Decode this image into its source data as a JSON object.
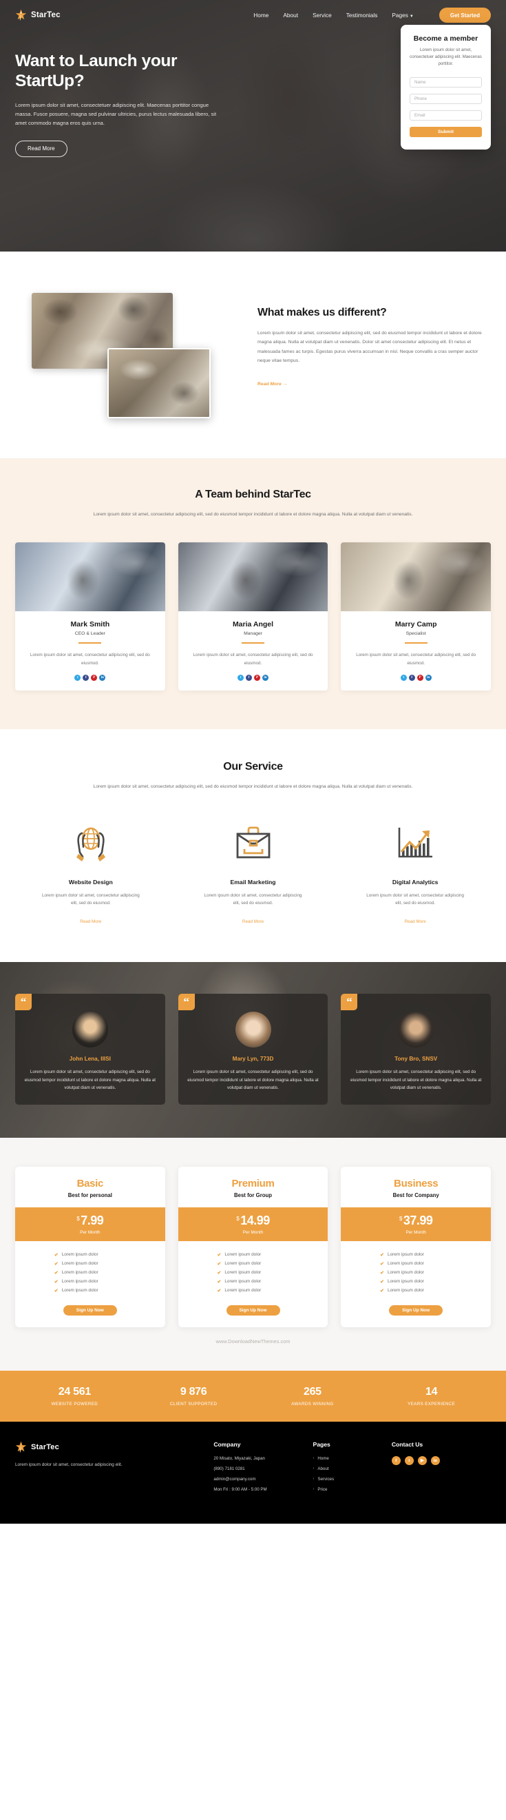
{
  "brand": {
    "name": "StarTec",
    "logo_icon": "star-icon"
  },
  "nav": {
    "items": [
      {
        "label": "Home"
      },
      {
        "label": "About"
      },
      {
        "label": "Service"
      },
      {
        "label": "Testimonials"
      },
      {
        "label": "Pages",
        "has_dropdown": true,
        "caret_icon": "chevron-down-icon"
      }
    ],
    "cta": "Get Started"
  },
  "hero": {
    "title_line1": "Want to Launch your",
    "title_line2": "StartUp?",
    "desc": "Lorem ipsum dolor sit amet, consectetuer adipiscing elit. Maecenas porttitor congue massa. Fusce posuere, magna sed pulvinar ultricies, purus lectus malesuada libero, sit amet commodo magna eros quis urna.",
    "button": "Read More"
  },
  "member_form": {
    "title": "Become a member",
    "subtitle": "Lorem ipsum dolor sit amet, consectetuer adipiscing elit. Maecenas porttitor.",
    "fields": [
      {
        "name": "name",
        "placeholder": "Name",
        "value": "",
        "type": "text"
      },
      {
        "name": "phone",
        "placeholder": "Phone",
        "value": "",
        "type": "number"
      },
      {
        "name": "email",
        "placeholder": "Email",
        "value": "",
        "type": "number"
      }
    ],
    "submit": "Submit"
  },
  "different": {
    "title": "What makes us different?",
    "desc": "Lorem ipsum dolor sit amet, consectetur adipiscing elit, sed do eiusmod tempor incididunt ut labore et dolore magna aliqua. Nulla at volutpat diam ut venenatis. Dolor sit amet consectetur adipiscing elit. Et netus et malesuada fames ac turpis. Egestas purus viverra accumsan in nisl. Neque convallis a cras semper auctor neque vitae tempus.",
    "link": "Read More  →"
  },
  "team": {
    "title": "A Team behind StarTec",
    "subtitle": "Lorem ipsum dolor sit amet, consectetur adipiscing elit, sed do eiusmod tempor incididunt ut labore et dolore magna aliqua. Nulla at volutpat diam ut venenatis.",
    "members": [
      {
        "name": "Mark Smith",
        "role": "CEO & Leader",
        "desc": "Lorem ipsum dolor sit amet, consectetur adipiscing elit, sed do eiusmod."
      },
      {
        "name": "Maria Angel",
        "role": "Manager",
        "desc": "Lorem ipsum dolor sit amet, consectetur adipiscing elit, sed do eiusmod."
      },
      {
        "name": "Marry Camp",
        "role": "Specialist",
        "desc": "Lorem ipsum dolor sit amet, consectetur adipiscing elit, sed do eiusmod."
      }
    ],
    "social_icons": [
      "twitter-icon",
      "facebook-icon",
      "pinterest-icon",
      "linkedin-icon"
    ]
  },
  "service": {
    "title": "Our Service",
    "subtitle": "Lorem ipsum dolor sit amet, consectetur adipiscing elit, sed do eiusmod tempor incididunt ut labore et dolore magna aliqua. Nulla at volutpat diam ut venenatis.",
    "items": [
      {
        "icon": "globe-in-hands-icon",
        "title": "Website Design",
        "desc": "Lorem ipsum dolor sit amet, consectetur adipiscing elit, sed do eiusmod.",
        "link": "Read More"
      },
      {
        "icon": "briefcase-icon",
        "title": "Email Marketing",
        "desc": "Lorem ipsum dolor sit amet, consectetur adipiscing elit, sed do eiusmod.",
        "link": "Read More"
      },
      {
        "icon": "bar-chart-growth-icon",
        "title": "Digital Analytics",
        "desc": "Lorem ipsum dolor sit amet, consectetur adipiscing elit, sed do eiusmod.",
        "link": "Read More"
      }
    ]
  },
  "testimonials": {
    "quote_icon": "quote-mark-icon",
    "items": [
      {
        "name": "John Lena, IIISI",
        "text": "Lorem ipsum dolor sit amet, consectetur adipiscing elit, sed do eiusmod tempor incididunt ut labore et dolore magna aliqua. Nulla at volutpat diam ut venenatis."
      },
      {
        "name": "Mary Lyn, 773D",
        "text": "Lorem ipsum dolor sit amet, consectetur adipiscing elit, sed do eiusmod tempor incididunt ut labore et dolore magna aliqua. Nulla at volutpat diam ut venenatis."
      },
      {
        "name": "Tony Bro, SNSV",
        "text": "Lorem ipsum dolor sit amet, consectetur adipiscing elit, sed do eiusmod tempor incididunt ut labore et dolore magna aliqua. Nulla at volutpat diam ut venenatis."
      }
    ]
  },
  "pricing": {
    "plans": [
      {
        "name": "Basic",
        "tagline": "Best for personal",
        "currency": "$",
        "amount": "7.99",
        "period": "Per Month",
        "features": [
          "Lorem ipsum dolor",
          "Lorem ipsum dolor",
          "Lorem ipsum dolor",
          "Lorem ipsum dolor",
          "Lorem ipsum dolor"
        ],
        "cta": "Sign Up Now"
      },
      {
        "name": "Premium",
        "tagline": "Best for Group",
        "currency": "$",
        "amount": "14.99",
        "period": "Per Month",
        "features": [
          "Lorem ipsum dolor",
          "Lorem ipsum dolor",
          "Lorem ipsum dolor",
          "Lorem ipsum dolor",
          "Lorem ipsum dolor"
        ],
        "cta": "Sign Up Now"
      },
      {
        "name": "Business",
        "tagline": "Best for Company",
        "currency": "$",
        "amount": "37.99",
        "period": "Per Month",
        "features": [
          "Lorem ipsum dolor",
          "Lorem ipsum dolor",
          "Lorem ipsum dolor",
          "Lorem ipsum dolor",
          "Lorem ipsum dolor"
        ],
        "cta": "Sign Up Now"
      }
    ]
  },
  "watermark": "www.DownloadNewThemes.com",
  "stats": [
    {
      "number": "24 561",
      "label": "WEBSITE POWERED"
    },
    {
      "number": "9 876",
      "label": "CLIENT SUPPORTED"
    },
    {
      "number": "265",
      "label": "AWARDS WINNING"
    },
    {
      "number": "14",
      "label": "YEARS EXPERIENCE"
    }
  ],
  "footer": {
    "brand": "StarTec",
    "desc": "Lorem ipsum dolor sit amet, consectetur adipiscing elit.",
    "company": {
      "title": "Company",
      "lines": [
        "20 Misato, Miyazaki, Japan",
        "(890) 7181 0281",
        "admin@company.com",
        "Mon Fri : 9:00 AM - 5:00 PM"
      ]
    },
    "pages": {
      "title": "Pages",
      "items": [
        "Home",
        "About",
        "Services",
        "Price"
      ]
    },
    "contact": {
      "title": "Contact Us",
      "social_icons": [
        "facebook-icon",
        "twitter-icon",
        "youtube-icon",
        "linkedin-icon"
      ]
    }
  },
  "colors": {
    "accent": "#eda041",
    "dark": "#1b1b1b",
    "cream": "#fbf1e7",
    "footer_bg": "#000000"
  }
}
